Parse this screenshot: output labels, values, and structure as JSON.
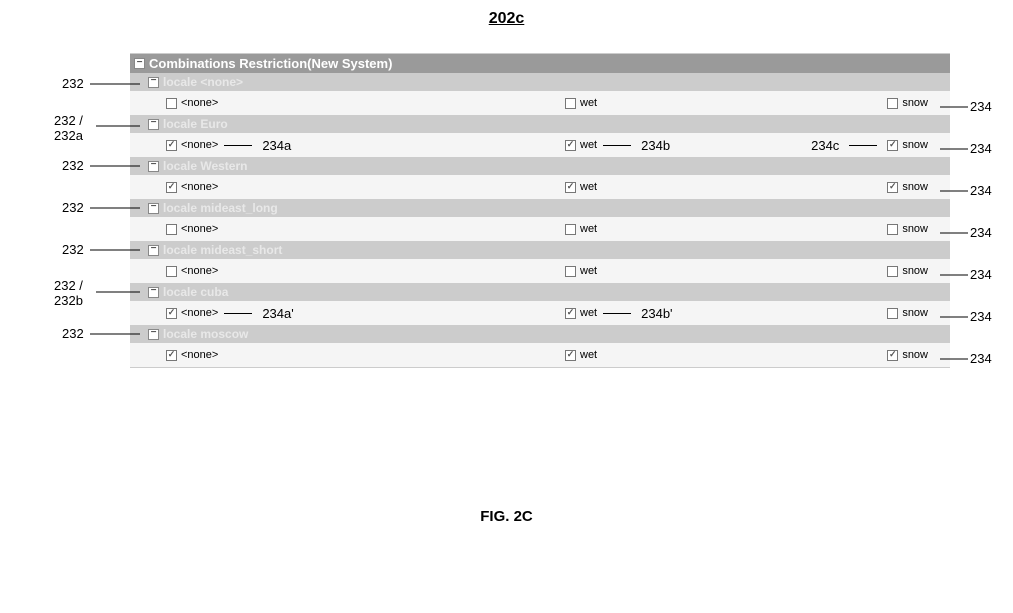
{
  "figure_ref": "202c",
  "figure_label": "FIG. 2C",
  "panel_title": "Combinations Restriction(New System)",
  "col_labels": {
    "none": "<none>",
    "wet": "wet",
    "snow": "snow"
  },
  "groups": [
    {
      "label": "locale <none>",
      "none": false,
      "wet": false,
      "snow": false
    },
    {
      "label": "locale Euro",
      "none": true,
      "wet": true,
      "snow": true
    },
    {
      "label": "locale Western",
      "none": true,
      "wet": true,
      "snow": true
    },
    {
      "label": "locale mideast_long",
      "none": false,
      "wet": false,
      "snow": false
    },
    {
      "label": "locale mideast_short",
      "none": false,
      "wet": false,
      "snow": false
    },
    {
      "label": "locale cuba",
      "none": true,
      "wet": true,
      "snow": false
    },
    {
      "label": "locale moscow",
      "none": true,
      "wet": true,
      "snow": true
    }
  ],
  "callouts": {
    "left": [
      "232",
      "232 /\n232a",
      "232",
      "232",
      "232",
      "232 /\n232b",
      "232"
    ],
    "right": [
      "234",
      "234",
      "234",
      "234",
      "234",
      "234",
      "234"
    ],
    "inline_row1": {
      "a": "234a",
      "b": "234b",
      "c": "234c"
    },
    "inline_row5": {
      "a": "234a'",
      "b": "234b'"
    }
  }
}
